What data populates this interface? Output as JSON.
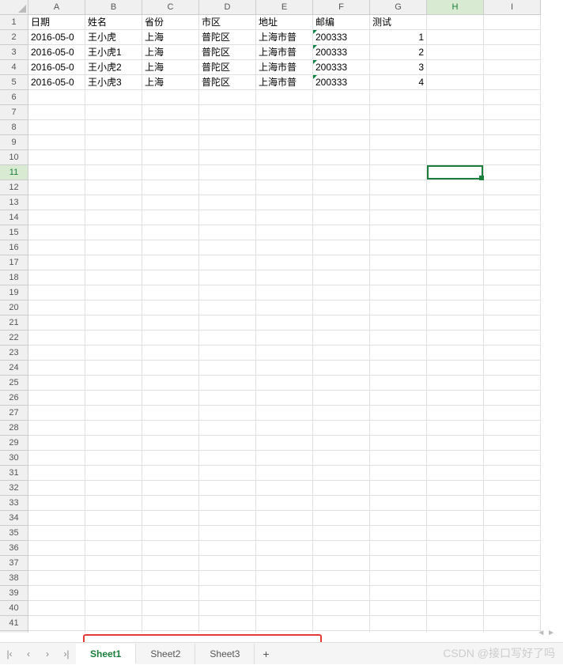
{
  "columns": [
    "A",
    "B",
    "C",
    "D",
    "E",
    "F",
    "G",
    "H",
    "I"
  ],
  "row_count": 42,
  "headers_row": [
    "日期",
    "姓名",
    "省份",
    "市区",
    "地址",
    "邮编",
    "测试"
  ],
  "data_rows": [
    {
      "date": "2016-05-0",
      "name": "王小虎",
      "prov": "上海",
      "city": "普陀区",
      "addr": "上海市普",
      "zip": "200333",
      "test": "1"
    },
    {
      "date": "2016-05-0",
      "name": "王小虎1",
      "prov": "上海",
      "city": "普陀区",
      "addr": "上海市普",
      "zip": "200333",
      "test": "2"
    },
    {
      "date": "2016-05-0",
      "name": "王小虎2",
      "prov": "上海",
      "city": "普陀区",
      "addr": "上海市普",
      "zip": "200333",
      "test": "3"
    },
    {
      "date": "2016-05-0",
      "name": "王小虎3",
      "prov": "上海",
      "city": "普陀区",
      "addr": "上海市普",
      "zip": "200333",
      "test": "4"
    }
  ],
  "active_cell": {
    "col": "H",
    "row": 11
  },
  "tabs": [
    "Sheet1",
    "Sheet2",
    "Sheet3"
  ],
  "active_tab": 0,
  "watermark": "CSDN @接口写好了吗"
}
